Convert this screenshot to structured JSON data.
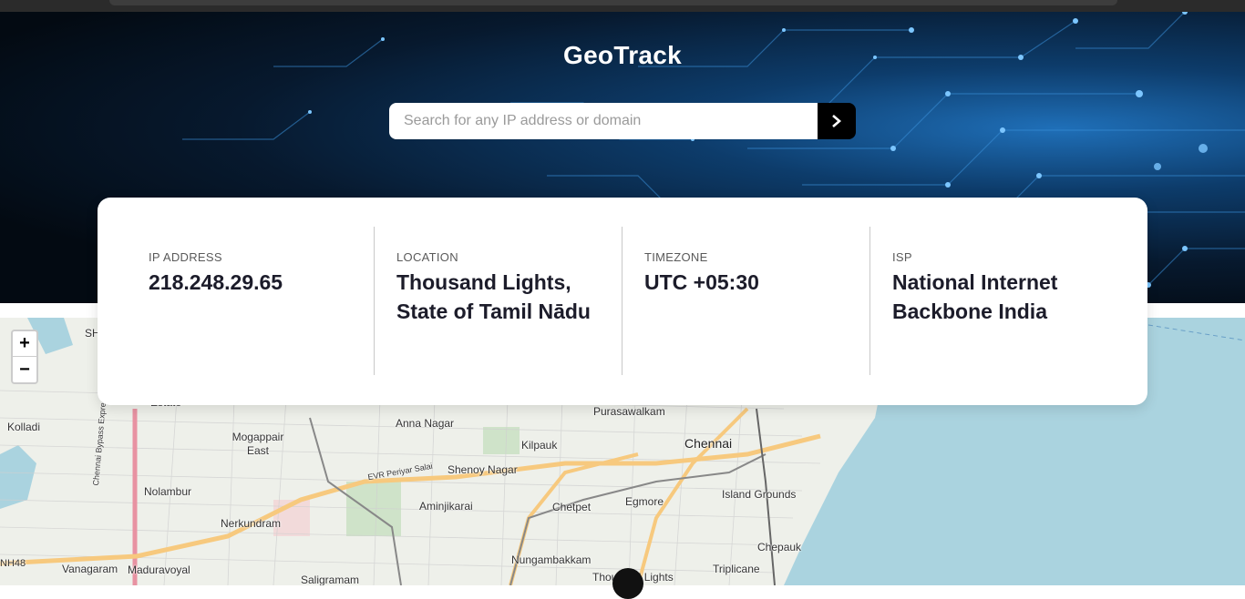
{
  "header": {
    "title": "GeoTrack"
  },
  "search": {
    "placeholder": "Search for any IP address or domain",
    "value": ""
  },
  "info": [
    {
      "label": "IP ADDRESS",
      "value": "218.248.29.65"
    },
    {
      "label": "LOCATION",
      "value": "Thousand Lights, State of Tamil Nādu"
    },
    {
      "label": "TIMEZONE",
      "value": "UTC +05:30"
    },
    {
      "label": "ISP",
      "value": "National Internet Backbone India"
    }
  ],
  "map": {
    "zoom_in": "+",
    "zoom_out": "−",
    "labels": {
      "estate": "Estate",
      "kolladi": "Kolladi",
      "mogappair_east": "Mogappair East",
      "anna_nagar": "Anna Nagar",
      "purasawalkam": "Purasawalkam",
      "kilpauk": "Kilpauk",
      "chennai": "Chennai",
      "shenoy_nagar": "Shenoy Nagar",
      "nolambur": "Nolambur",
      "aminjikarai": "Aminjikarai",
      "chetpet": "Chetpet",
      "egmore": "Egmore",
      "island_grounds": "Island Grounds",
      "nerkundram": "Nerkundram",
      "chepauk": "Chepauk",
      "nh48": "NH48",
      "vanagaram": "Vanagaram",
      "maduravoyal": "Maduravoyal",
      "nungambakkam": "Nungambakkam",
      "triplicane": "Triplicane",
      "saligramam": "Saligramam",
      "thousand_lights": "Thousand Lights",
      "sh": "SH",
      "road_evr": "EVR Periyar Salai",
      "road_bypass": "Chennai Bypass Expressway"
    },
    "colors": {
      "water": "#aad3df",
      "land": "#eef0ea",
      "major_road": "#f7c97e",
      "motorway": "#e892a2"
    }
  }
}
